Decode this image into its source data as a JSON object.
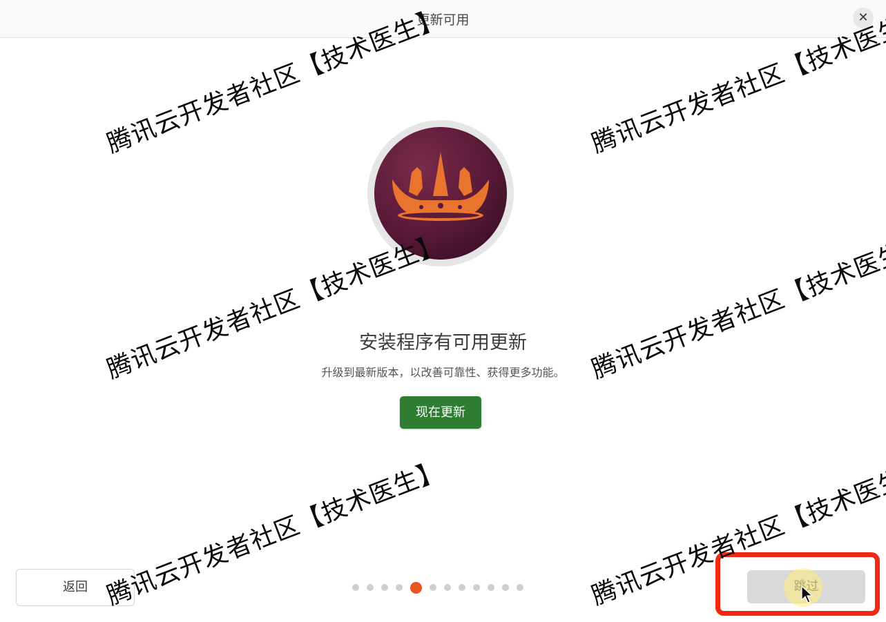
{
  "window": {
    "title": "更新可用",
    "close_icon": "✕"
  },
  "content": {
    "headline": "安装程序有可用更新",
    "subline": "升级到最新版本，以改善可靠性、获得更多功能。",
    "update_button": "现在更新"
  },
  "footer": {
    "back_button": "返回",
    "skip_button": "跳过",
    "pager": {
      "total": 12,
      "current": 4
    }
  },
  "watermark": {
    "text": "腾讯云开发者社区【技术医生】"
  },
  "colors": {
    "accent_orange": "#e95420",
    "update_green": "#2e7d32",
    "highlight_red": "#ee2a14",
    "logo_purple": "#5a1a38"
  },
  "icons": {
    "logo": "ubuntu-crown-logo-icon",
    "close": "close-icon",
    "cursor": "mouse-pointer-icon"
  }
}
